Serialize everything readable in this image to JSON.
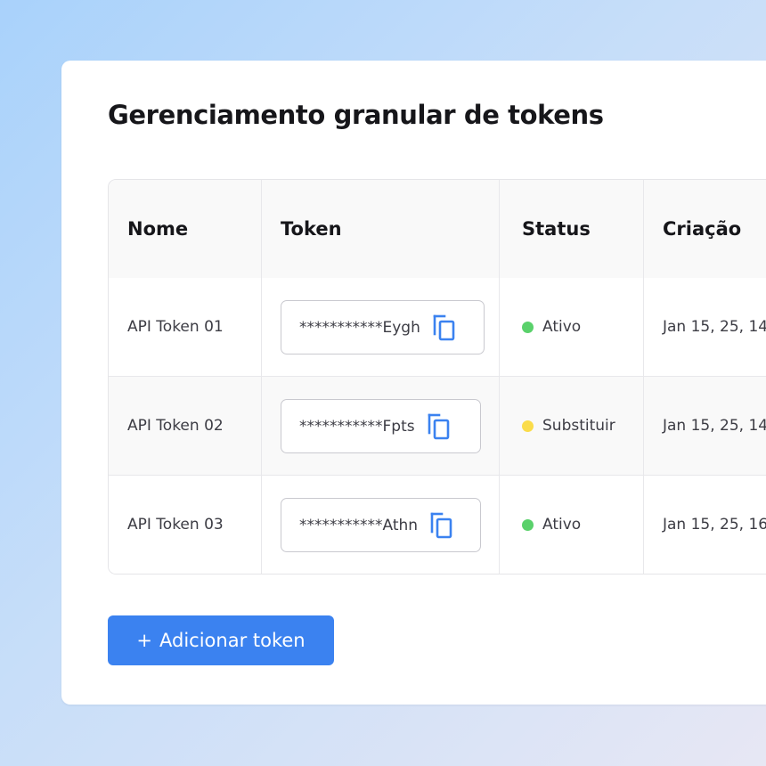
{
  "title": "Gerenciamento granular de tokens",
  "table": {
    "columns": [
      "Nome",
      "Token",
      "Status",
      "Criação"
    ],
    "rows": [
      {
        "name": "API Token 01",
        "token": "***********Eygh",
        "status": "Ativo",
        "status_color": "#5ad16b",
        "created": "Jan 15, 25, 14:"
      },
      {
        "name": "API Token 02",
        "token": "***********Fpts",
        "status": "Substituir",
        "status_color": "#fadc4a",
        "created": "Jan 15, 25, 14:"
      },
      {
        "name": "API Token 03",
        "token": "***********Athn",
        "status": "Ativo",
        "status_color": "#5ad16b",
        "created": "Jan 15, 25, 16:"
      }
    ],
    "copy_icon": "copy-icon"
  },
  "add_button": {
    "icon": "plus",
    "plus_glyph": "+",
    "label": "Adicionar token"
  },
  "colors": {
    "accent": "#3b82f0",
    "status_active": "#5ad16b",
    "status_replace": "#fadc4a"
  }
}
